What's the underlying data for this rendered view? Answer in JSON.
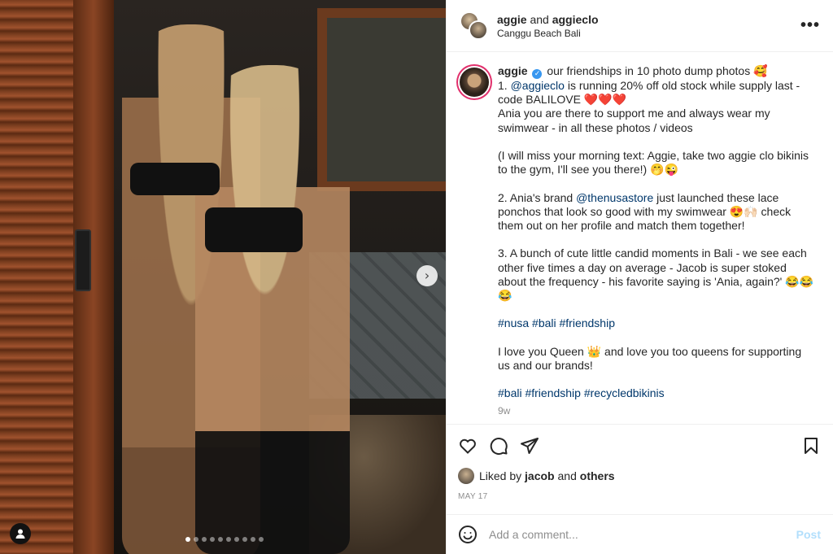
{
  "photo": {
    "carousel_total": 10,
    "carousel_active_index": 0
  },
  "header": {
    "user1": "aggie",
    "joiner": "and",
    "user2": "aggieclo",
    "location": "Canggu Beach Bali",
    "more_label": "•••"
  },
  "caption": {
    "username": "aggie",
    "verified_mark": "✓",
    "line1": "our friendships in 10 photo dump photos 🥰",
    "l2a": "1. ",
    "l2_mention": "@aggieclo",
    "l2b": " is running 20% off old stock while supply last - code BALILOVE ❤️❤️❤️",
    "l3": "Ania you are there to support me and always wear my swimwear - in all these photos / videos",
    "l4": "(I will miss your morning text: Aggie, take two aggie clo bikinis to the gym, I'll see you there!) 🤭😜",
    "l5a": "2. Ania's brand ",
    "l5_mention": "@thenusastore",
    "l5b": " just launched these lace ponchos that look so good with my swimwear 😍🙌🏻 check them out on her profile and match them together!",
    "l6": "3. A bunch of cute little candid moments in Bali - we see each other five times a day on average - Jacob is super stoked about the frequency - his favorite saying is 'Ania, again?' 😂😂😂",
    "hashtags1": "#nusa #bali #friendship",
    "l7": "I love you Queen 👑 and love you too queens for supporting us and our brands!",
    "hashtags2": "#bali #friendship #recycledbikinis",
    "time": "9w"
  },
  "actions": {
    "liked_by_prefix": "Liked by ",
    "liked_by_user": "jacob",
    "liked_by_joiner": " and ",
    "liked_by_others": "others",
    "date": "MAY 17"
  },
  "comment": {
    "placeholder": "Add a comment...",
    "post_label": "Post"
  },
  "colors": {
    "link": "#00376b",
    "post_disabled": "#b2dffc",
    "story_ring": "#e1306c",
    "verified": "#3897f0"
  }
}
